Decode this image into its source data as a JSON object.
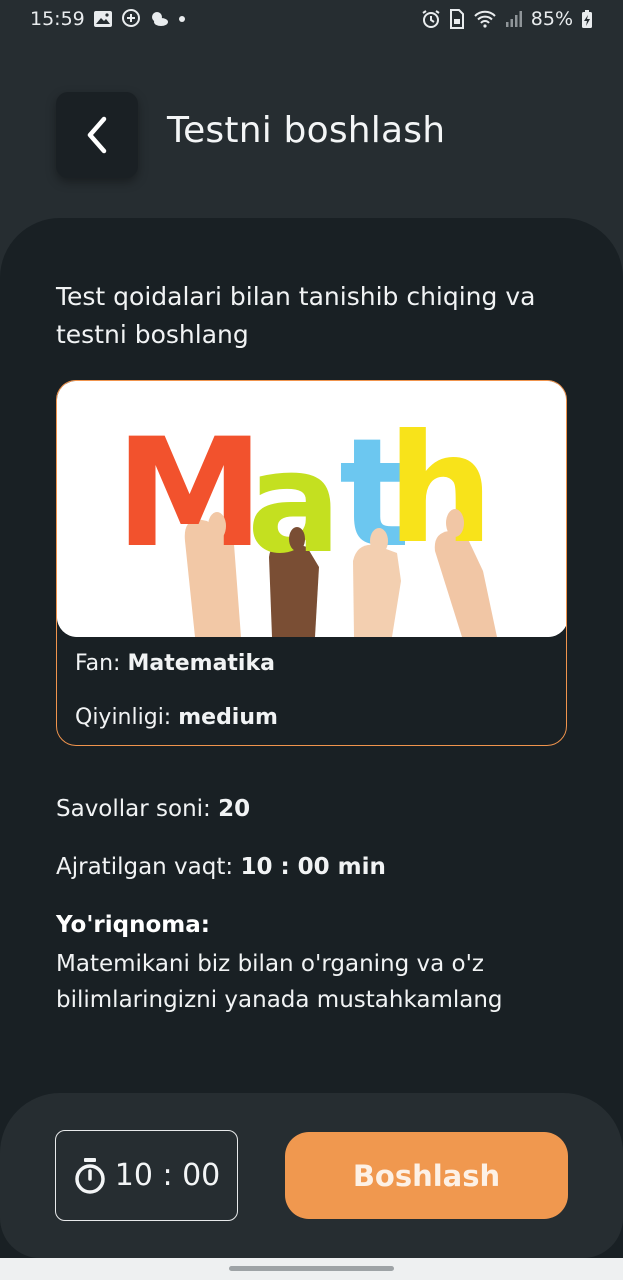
{
  "status_bar": {
    "time": "15:59",
    "battery": "85%",
    "left_icons": [
      "gallery-icon",
      "chat-add-icon",
      "weather-icon",
      "dot-icon"
    ],
    "right_icons": [
      "alarm-icon",
      "sim-lock-icon",
      "wifi-icon",
      "signal-icon",
      "battery-charging-icon"
    ]
  },
  "header": {
    "back_icon": "chevron-left-icon",
    "title": "Testni boshlash"
  },
  "intro": "Test qoidalari bilan tanishib chiqing va testni boshlang",
  "card": {
    "image_text": "Math",
    "subject_label": "Fan: ",
    "subject_value": "Matematika",
    "difficulty_label": "Qiyinligi: ",
    "difficulty_value": "medium"
  },
  "details": {
    "questions_label": "Savollar soni: ",
    "questions_value": "20",
    "time_label": "Ajratilgan vaqt: ",
    "time_value": "10 : 00 min",
    "guide_title": "Yo'riqnoma:",
    "guide_text": "Matemikani biz bilan o'rganing va o'z bilimlaringizni yanada mustahkamlang"
  },
  "bottom": {
    "timer_icon": "stopwatch-icon",
    "timer": "10 : 00",
    "start_label": "Boshlash"
  },
  "colors": {
    "accent": "#f0984f",
    "card_border": "#f0944d",
    "background": "#262d31",
    "sheet": "#192024"
  }
}
